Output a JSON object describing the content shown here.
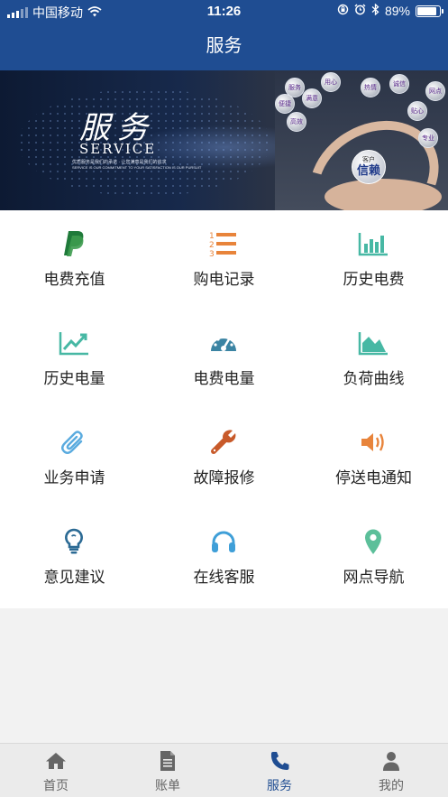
{
  "status_bar": {
    "carrier": "中国移动",
    "time": "11:26",
    "battery": "89%",
    "battery_level": 0.89
  },
  "header": {
    "title": "服务"
  },
  "banner": {
    "title": "服务",
    "subtitle": "SERVICE",
    "line1": "优质服务是我们的承诺 · 让您满意是我们的追求",
    "line2": "SERVICE IS OUR COMMITMENT TO YOUR SATISFACTION IS OUR PURSUIT",
    "bubbles": [
      "服务",
      "用心",
      "热情",
      "诚信",
      "网点",
      "满意",
      "便捷",
      "高效",
      "贴心",
      "专业"
    ],
    "trust_small": "客户",
    "trust_big": "信赖"
  },
  "services": [
    {
      "label": "电费充值",
      "icon": "paypal-icon",
      "color": "#3d9b4f"
    },
    {
      "label": "购电记录",
      "icon": "numbered-list-icon",
      "color": "#e8843b"
    },
    {
      "label": "历史电费",
      "icon": "bar-chart-icon",
      "color": "#47b8a4"
    },
    {
      "label": "历史电量",
      "icon": "line-chart-icon",
      "color": "#47b8a4"
    },
    {
      "label": "电费电量",
      "icon": "dashboard-icon",
      "color": "#3b84a3"
    },
    {
      "label": "负荷曲线",
      "icon": "area-chart-icon",
      "color": "#47b8a4"
    },
    {
      "label": "业务申请",
      "icon": "paperclip-icon",
      "color": "#5aabdf"
    },
    {
      "label": "故障报修",
      "icon": "wrench-icon",
      "color": "#c85a2a"
    },
    {
      "label": "停送电通知",
      "icon": "volume-icon",
      "color": "#e8843b"
    },
    {
      "label": "意见建议",
      "icon": "lightbulb-icon",
      "color": "#2b6a94"
    },
    {
      "label": "在线客服",
      "icon": "headphones-icon",
      "color": "#3f9fd8"
    },
    {
      "label": "网点导航",
      "icon": "map-marker-icon",
      "color": "#5cbf9a"
    }
  ],
  "tabs": [
    {
      "label": "首页",
      "icon": "home-icon",
      "active": false
    },
    {
      "label": "账单",
      "icon": "document-icon",
      "active": false
    },
    {
      "label": "服务",
      "icon": "phone-icon",
      "active": true
    },
    {
      "label": "我的",
      "icon": "user-icon",
      "active": false
    }
  ],
  "colors": {
    "brand": "#1f4d92",
    "tab_inactive": "#666666",
    "tab_active": "#1f4d92"
  }
}
